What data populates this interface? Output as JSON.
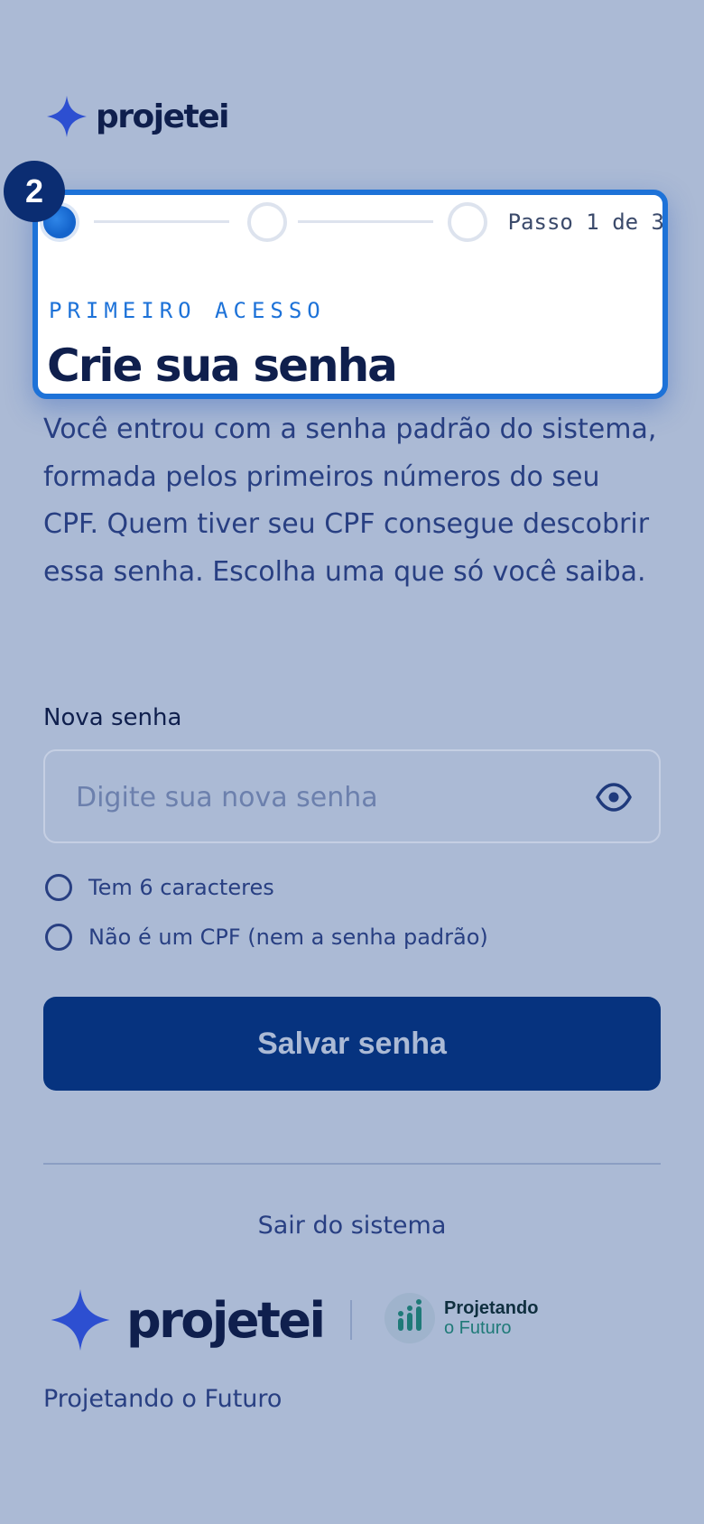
{
  "brand": {
    "name": "projetei"
  },
  "step_badge": "2",
  "stepper": {
    "counter": "Passo 1 de 3",
    "total_steps": 3,
    "current_step": 1
  },
  "card": {
    "eyebrow": "PRIMEIRO ACESSO",
    "title": "Crie sua senha"
  },
  "description": "Você entrou com a senha padrão do sistema, formada pelos primeiros números do seu CPF. Quem tiver seu CPF consegue descobrir essa senha. Escolha uma que só você saiba.",
  "form": {
    "password_label": "Nova senha",
    "password_placeholder": "Digite sua nova senha",
    "password_value": "",
    "requirements": [
      "Tem 6 caracteres",
      "Não é um CPF (nem a senha padrão)"
    ],
    "submit_label": "Salvar senha"
  },
  "logout_label": "Sair do sistema",
  "partner": {
    "line1": "Projetando",
    "line2": "o Futuro"
  },
  "footer_caption": "Projetando o Futuro",
  "colors": {
    "background": "#abbad5",
    "primary": "#06337f",
    "accent": "#1d72d8",
    "brand_star": "#2d4fd1",
    "partner_teal": "#1f7a78"
  },
  "icons": {
    "brand": "star-icon",
    "show_password": "eye-icon",
    "partner": "bar-chart-icon"
  }
}
